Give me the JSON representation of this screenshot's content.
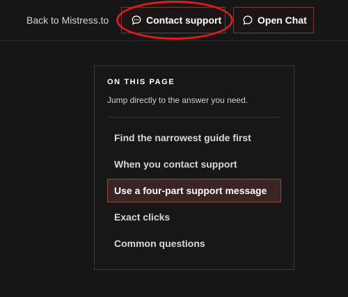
{
  "header": {
    "back_link": "Back to Mistress.to",
    "contact_button": "Contact support",
    "chat_button": "Open Chat",
    "icons": {
      "contact": "chat-bubble-dots-icon",
      "chat": "chat-bubble-icon"
    }
  },
  "toc": {
    "heading": "ON THIS PAGE",
    "subtitle": "Jump directly to the answer you need.",
    "items": [
      {
        "label": "Find the narrowest guide first"
      },
      {
        "label": "When you contact support"
      },
      {
        "label": "Use a four-part support message"
      },
      {
        "label": "Exact clicks"
      },
      {
        "label": "Common questions"
      }
    ],
    "active_index": 2
  },
  "colors": {
    "background": "#161616",
    "button_border": "#7a3a34",
    "active_item_bg": "#3a2424",
    "active_item_border": "#8a4a40",
    "annotation_ring": "#e01b1b"
  }
}
